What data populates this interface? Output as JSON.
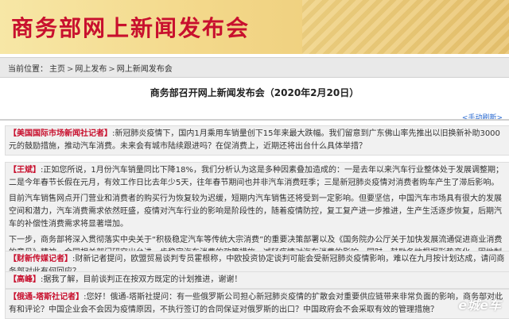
{
  "banner": {
    "title": "商务部网上新闻发布会"
  },
  "breadcrumb": {
    "prefix": "当前位置：",
    "items": [
      "主页",
      "网上发布",
      "网上新闻发布会"
    ],
    "separator": ">"
  },
  "page": {
    "title": "商务部召开网上新闻发布会（2020年2月20日）",
    "refresh_link": "<手动刷新>"
  },
  "qa": [
    {
      "speaker": "【美国国际市场新闻社记者】",
      "text": ":新冠肺炎疫情下，国内1月乘用车销量创下15年来最大跌幅。我们留意到广东佛山率先推出以旧换新补助3000元的鼓励措施，推动汽车消费。未来会有城市陆续跟进吗？在促消费上，近期还将出台什么具体举措？"
    },
    {
      "speaker": "【王斌】",
      "text": ":正如您所说，1月份汽车销量同比下降18%，我们分析认为这是多种因素叠加造成的：一是去年以来汽车行业整体处于发展调整期；二是今年春节长假在元月，有效工作日比去年少5天，往年春节期间也并非汽车消费旺季；三是新冠肺炎疫情对消费者购车产生了滞后影响。"
    },
    {
      "speaker": "",
      "text": "目前汽车销售网点开门营业和消费者的购买行为恢复较为迟缓，短期内汽车销售还将受到一定影响。但要坚信，中国汽车市场具有很大的发展空间和潜力，汽车消费需求依然旺盛，疫情对汽车行业的影响是阶段性的，随着疫情防控，复工复产进一步推进，生产生活逐步恢复，后期汽车的补偿性消费需求将显著增加。"
    },
    {
      "speaker": "",
      "text": "下一步，商务部将深入贯彻落实中央关于“积极稳定汽车等传统大宗消费”的重要决策部署以及《国务院办公厅关于加快发展流通促进商业消费的意见》精神，会同相关部门研究出台进一步稳定汽车消费的政策措施，减轻疫情对汽车消费的影响。同时，鼓励各地根据形势变化，因地制宜出台促进新能源汽车消费，增加传统汽车限购指标和开展汽车以旧换新等举措，促进汽车消费，谢谢！"
    },
    {
      "speaker": "【财新传媒记者】",
      "text": ":财新记者提问，欧盟贸易谈判专员霍根称，中欧投资协定谈判可能会受新冠肺炎疫情影响，难以在九月按计划达成，请问商务部对此有何回应？"
    },
    {
      "speaker": "【高峰】",
      "text": ":据我了解，目前谈判正在按双方既定的计划推进，谢谢！"
    },
    {
      "speaker": "【俄通-塔斯社记者】",
      "text": ":您好！俄通-塔斯社提问：有一些俄罗斯公司担心新冠肺炎疫情的扩散会对重要供应链带来非常负面的影响，商务部对此有和评论？中国企业会不会因为疫情原因，不执行签订的合同保证对俄罗斯的出口？中国政府会不会采取有效的管理措施？"
    }
  ],
  "watermark": "e城e车"
}
